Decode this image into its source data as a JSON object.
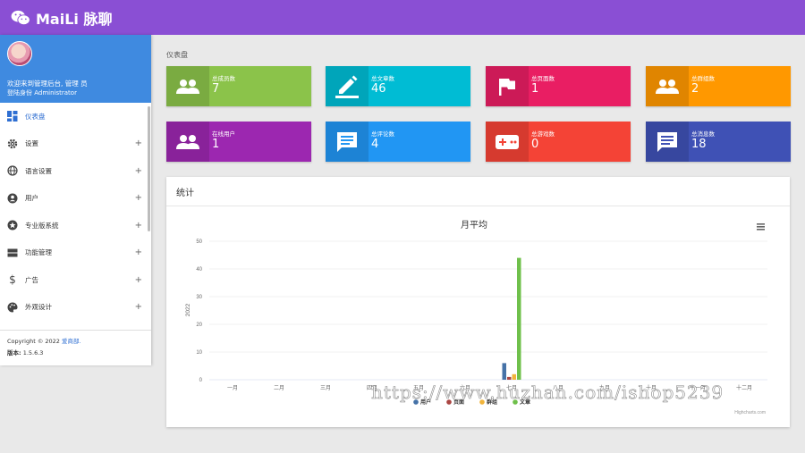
{
  "app": {
    "title": "MaiLi 脉聊"
  },
  "profile": {
    "welcome": "欢迎来到管理后台, 管理 员",
    "role": "登陆身份 Administrator"
  },
  "menu": [
    {
      "label": "仪表盘",
      "icon": "dashboard-icon",
      "active": true,
      "expandable": false
    },
    {
      "label": "设置",
      "icon": "gear-icon",
      "expandable": true
    },
    {
      "label": "语言设置",
      "icon": "globe-icon",
      "expandable": true
    },
    {
      "label": "用户",
      "icon": "user-icon",
      "expandable": true
    },
    {
      "label": "专业版系统",
      "icon": "star-icon",
      "expandable": true
    },
    {
      "label": "功能管理",
      "icon": "server-icon",
      "expandable": true
    },
    {
      "label": "广告",
      "icon": "dollar-icon",
      "expandable": true
    },
    {
      "label": "外观设计",
      "icon": "palette-icon",
      "expandable": true
    }
  ],
  "footer": {
    "copyright": "Copyright © 2022",
    "company": "爱商部.",
    "version_label": "版本:",
    "version": "1.5.6.3"
  },
  "page_title": "仪表盘",
  "cards": [
    {
      "label": "总成员数",
      "value": "7",
      "color": "#8bc34a",
      "icon": "people-icon"
    },
    {
      "label": "总文章数",
      "value": "46",
      "color": "#00bcd4",
      "icon": "pencil-icon"
    },
    {
      "label": "总页面数",
      "value": "1",
      "color": "#e91e63",
      "icon": "flag-icon"
    },
    {
      "label": "总群组数",
      "value": "2",
      "color": "#ff9800",
      "icon": "group-icon"
    },
    {
      "label": "在线用户",
      "value": "1",
      "color": "#9c27b0",
      "icon": "people-icon"
    },
    {
      "label": "总评论数",
      "value": "4",
      "color": "#2196f3",
      "icon": "comment-icon"
    },
    {
      "label": "总游戏数",
      "value": "0",
      "color": "#f44336",
      "icon": "gamepad-icon"
    },
    {
      "label": "总消息数",
      "value": "18",
      "color": "#3f51b5",
      "icon": "message-icon"
    }
  ],
  "panel": {
    "title": "统计"
  },
  "chart_data": {
    "type": "bar",
    "title": "月平均",
    "ylabel": "2022",
    "xlabel": "",
    "ylim": [
      0,
      50
    ],
    "yticks": [
      0,
      10,
      20,
      30,
      40,
      50
    ],
    "categories": [
      "一月",
      "二月",
      "三月",
      "四月",
      "五月",
      "六月",
      "七月",
      "八月",
      "九月",
      "十月",
      "十一月",
      "十二月"
    ],
    "tick_labels_visible": [
      "一月",
      "二月",
      "三月",
      "四月",
      "五月",
      "六月",
      "七月",
      "八月",
      "九月",
      "十月",
      "十一月",
      "十二月"
    ],
    "series": [
      {
        "name": "用户",
        "color": "#4572a7",
        "values": [
          0,
          0,
          0,
          0,
          0,
          0,
          6,
          0,
          0,
          0,
          0,
          0
        ]
      },
      {
        "name": "页面",
        "color": "#aa4643",
        "values": [
          0,
          0,
          0,
          0,
          0,
          0,
          1,
          0,
          0,
          0,
          0,
          0
        ]
      },
      {
        "name": "群组",
        "color": "#f1b43b",
        "values": [
          0,
          0,
          0,
          0,
          0,
          0,
          2,
          0,
          0,
          0,
          0,
          0
        ]
      },
      {
        "name": "文章",
        "color": "#6fc04b",
        "values": [
          0,
          0,
          0,
          0,
          0,
          0,
          44,
          0,
          0,
          0,
          0,
          0
        ]
      }
    ],
    "legend": "bottom",
    "grid": true,
    "credit": "Highcharts.com"
  },
  "watermark": "https://www.huzhan.com/ishop5239"
}
